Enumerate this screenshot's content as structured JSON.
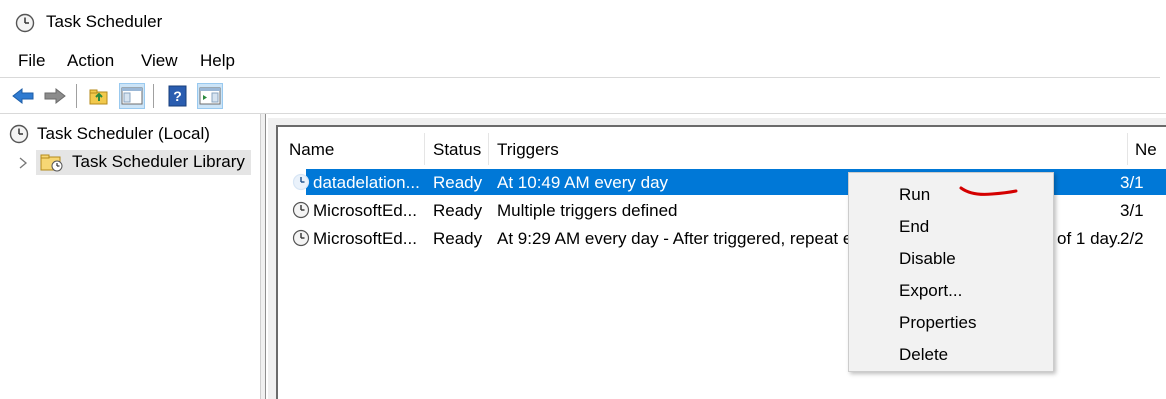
{
  "window": {
    "title": "Task Scheduler",
    "app_icon": "clock-icon"
  },
  "menu": [
    "File",
    "Action",
    "View",
    "Help"
  ],
  "toolbar": {
    "buttons": [
      "back-arrow-icon",
      "forward-arrow-icon",
      "up-folder-icon",
      "show-hide-console-tree-icon",
      "help-icon",
      "show-hide-action-pane-icon"
    ]
  },
  "tree": {
    "root": "Task Scheduler (Local)",
    "library": "Task Scheduler Library"
  },
  "list": {
    "columns": [
      "Name",
      "Status",
      "Triggers",
      "Ne"
    ],
    "rows": [
      {
        "name": "datadelation...",
        "status": "Ready",
        "triggers": "At 10:49 AM every day",
        "next": "3/1",
        "selected": true
      },
      {
        "name": "MicrosoftEd...",
        "status": "Ready",
        "triggers": "Multiple triggers defined",
        "next": "3/1",
        "selected": false
      },
      {
        "name": "MicrosoftEd...",
        "status": "Ready",
        "triggers": "At 9:29 AM every day - After triggered, repeat e",
        "trigger_tail": "of 1 day.",
        "next": "2/2",
        "selected": false
      }
    ]
  },
  "context_menu": [
    "Run",
    "End",
    "Disable",
    "Export...",
    "Properties",
    "Delete"
  ],
  "colors": {
    "selection": "#0078d7",
    "annotation": "#d40000",
    "menu_bg": "#f2f2f2"
  }
}
